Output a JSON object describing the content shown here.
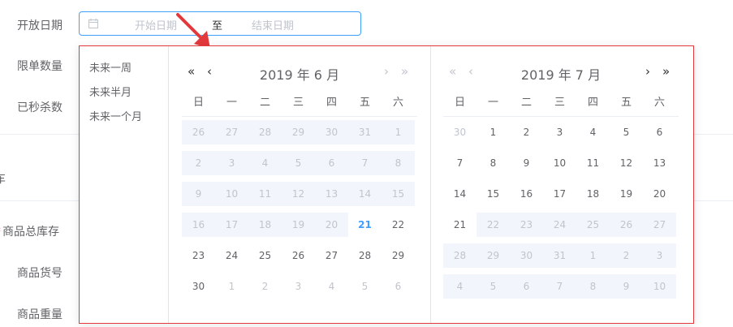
{
  "form": {
    "labels": {
      "open_date": "开放日期",
      "limit_qty": "限单数量",
      "seckill_count": "已秒杀数",
      "partial": "车",
      "total_stock": "商品总库存",
      "sku": "商品货号",
      "weight": "商品重量"
    },
    "required_mark": "*"
  },
  "date_range": {
    "start_placeholder": "开始日期",
    "separator": "至",
    "end_placeholder": "结束日期"
  },
  "shortcuts": [
    "未来一周",
    "未来半月",
    "未来一个月"
  ],
  "weekdays": [
    "日",
    "一",
    "二",
    "三",
    "四",
    "五",
    "六"
  ],
  "left_month": {
    "title": "2019 年 6 月",
    "rows": [
      [
        "26",
        "27",
        "28",
        "29",
        "30",
        "31",
        "1"
      ],
      [
        "2",
        "3",
        "4",
        "5",
        "6",
        "7",
        "8"
      ],
      [
        "9",
        "10",
        "11",
        "12",
        "13",
        "14",
        "15"
      ],
      [
        "16",
        "17",
        "18",
        "19",
        "20",
        "21",
        "22"
      ],
      [
        "23",
        "24",
        "25",
        "26",
        "27",
        "28",
        "29"
      ],
      [
        "30",
        "1",
        "2",
        "3",
        "4",
        "5",
        "6"
      ]
    ]
  },
  "right_month": {
    "title": "2019 年 7 月",
    "rows": [
      [
        "30",
        "1",
        "2",
        "3",
        "4",
        "5",
        "6"
      ],
      [
        "7",
        "8",
        "9",
        "10",
        "11",
        "12",
        "13"
      ],
      [
        "14",
        "15",
        "16",
        "17",
        "18",
        "19",
        "20"
      ],
      [
        "21",
        "22",
        "23",
        "24",
        "25",
        "26",
        "27"
      ],
      [
        "28",
        "29",
        "30",
        "31",
        "1",
        "2",
        "3"
      ],
      [
        "4",
        "5",
        "6",
        "7",
        "8",
        "9",
        "10"
      ]
    ]
  },
  "nav_icons": {
    "prev_year": "«",
    "prev_month": "‹",
    "next_month": "›",
    "next_year": "»"
  },
  "colors": {
    "accent": "#409eff",
    "annotation": "#e4393c",
    "disabled_band": "#f2f6fc"
  }
}
